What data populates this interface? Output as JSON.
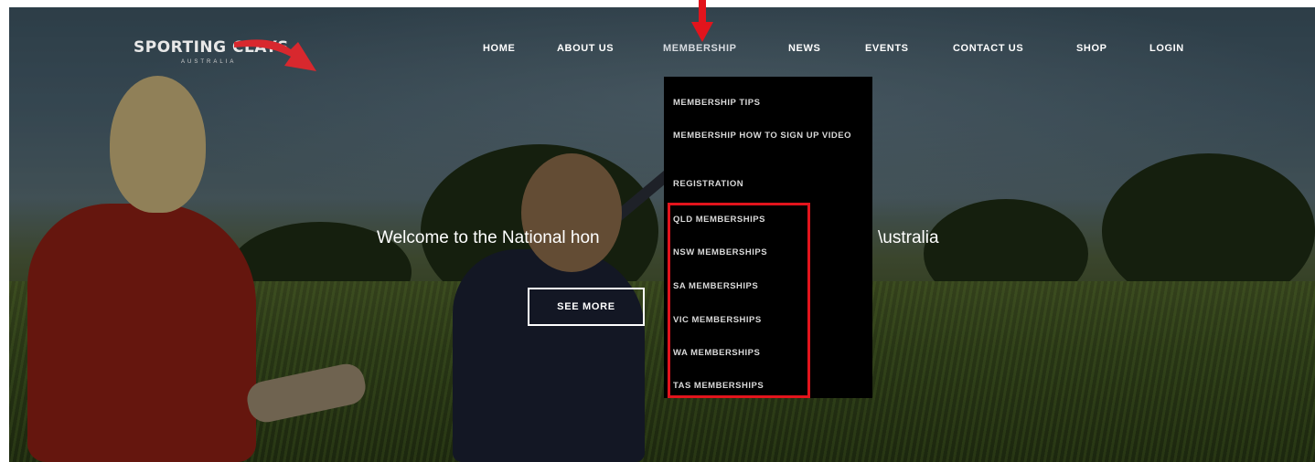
{
  "logo": {
    "title": "SPORTING CLAYS",
    "subtitle": "AUSTRALIA"
  },
  "nav": {
    "items": [
      {
        "label": "HOME"
      },
      {
        "label": "ABOUT US"
      },
      {
        "label": "MEMBERSHIP"
      },
      {
        "label": "NEWS"
      },
      {
        "label": "EVENTS"
      },
      {
        "label": "CONTACT US"
      },
      {
        "label": "SHOP"
      },
      {
        "label": "LOGIN"
      }
    ],
    "active": "MEMBERSHIP"
  },
  "dropdown": {
    "items": [
      "MEMBERSHIP TIPS",
      "MEMBERSHIP HOW TO SIGN UP VIDEO",
      "REGISTRATION",
      "QLD MEMBERSHIPS",
      "NSW MEMBERSHIPS",
      "SA MEMBERSHIPS",
      "VIC MEMBERSHIPS",
      "WA MEMBERSHIPS",
      "TAS MEMBERSHIPS"
    ]
  },
  "hero": {
    "text_left": "Welcome to the National hon",
    "text_right": "\\ustralia",
    "button_label": "SEE MORE"
  },
  "colors": {
    "annotation_red": "#e2141c",
    "dropdown_bg": "#000000",
    "nav_text": "#ffffff"
  }
}
